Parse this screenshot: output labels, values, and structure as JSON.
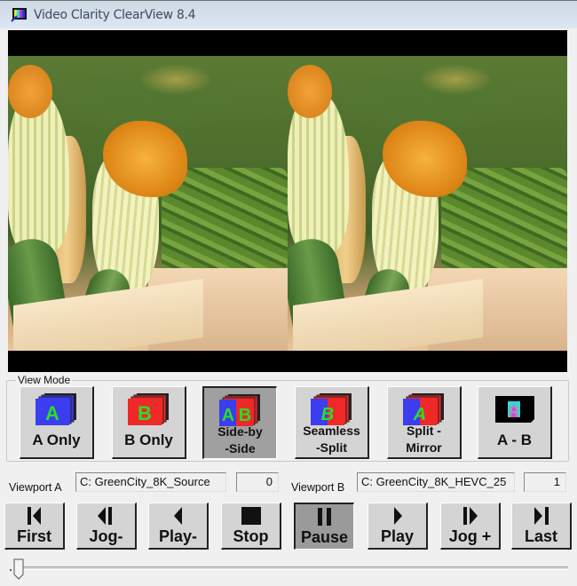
{
  "window": {
    "title": "Video Clarity ClearView 8.4",
    "app_icon": "clearview-app-icon"
  },
  "video": {
    "layout": "side-by-side",
    "viewports": [
      {
        "id": "A",
        "content": "squash blossoms and green beans in baskets"
      },
      {
        "id": "B",
        "content": "squash blossoms and green beans in baskets"
      }
    ]
  },
  "view_mode": {
    "group_label": "View Mode",
    "selected": "Side-by-Side",
    "buttons": [
      {
        "id": "a-only",
        "label": "A Only",
        "icon": "a-stack-icon",
        "active": false
      },
      {
        "id": "b-only",
        "label": "B Only",
        "icon": "b-stack-icon",
        "active": false
      },
      {
        "id": "side-by-side",
        "label_line1": "Side-by",
        "label_line2": "-Side",
        "icon": "ab-stack-icon",
        "active": true
      },
      {
        "id": "seamless-split",
        "label_line1": "Seamless",
        "label_line2": "-Split",
        "icon": "seamless-split-icon",
        "active": false
      },
      {
        "id": "split-mirror",
        "label_line1": "Split -",
        "label_line2": "Mirror",
        "icon": "split-mirror-icon",
        "active": false
      },
      {
        "id": "a-minus-b",
        "label": "A - B",
        "icon": "difference-icon",
        "active": false
      }
    ]
  },
  "viewport_a": {
    "label": "Viewport A",
    "source": "C: GreenCity_8K_Source",
    "frame": "0"
  },
  "viewport_b": {
    "label": "Viewport B",
    "source": "C: GreenCity_8K_HEVC_25",
    "frame": "1"
  },
  "transport": {
    "buttons": [
      {
        "id": "first",
        "label": "First",
        "icon": "skip-to-first-icon",
        "active": false
      },
      {
        "id": "jog-back",
        "label": "Jog-",
        "icon": "jog-back-icon",
        "active": false
      },
      {
        "id": "play-reverse",
        "label": "Play-",
        "icon": "play-reverse-icon",
        "active": false
      },
      {
        "id": "stop",
        "label": "Stop",
        "icon": "stop-icon",
        "active": false
      },
      {
        "id": "pause",
        "label": "Pause",
        "icon": "pause-icon",
        "active": true
      },
      {
        "id": "play",
        "label": "Play",
        "icon": "play-icon",
        "active": false
      },
      {
        "id": "jog-forward",
        "label": "Jog +",
        "icon": "jog-forward-icon",
        "active": false
      },
      {
        "id": "last",
        "label": "Last",
        "icon": "skip-to-last-icon",
        "active": false
      }
    ]
  },
  "timeline": {
    "position_fraction": 0.0
  },
  "colors": {
    "a_blue": "#3c3cf0",
    "b_red": "#f02828",
    "letter_green": "#28e028",
    "button_face": "#d4d4d4",
    "button_active": "#a0a0a0"
  }
}
